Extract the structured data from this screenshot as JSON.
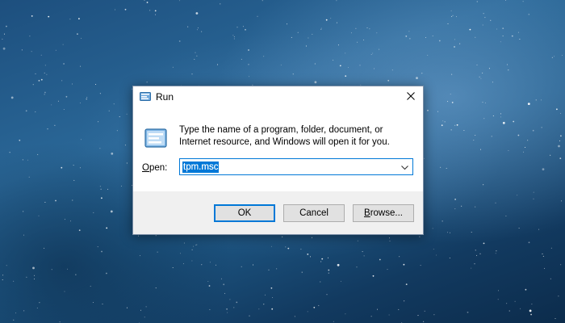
{
  "dialog": {
    "title": "Run",
    "close_icon": "close-icon",
    "app_icon": "run-icon",
    "description": "Type the name of a program, folder, document, or Internet resource, and Windows will open it for you.",
    "open_label_prefix": "O",
    "open_label_rest": "pen:",
    "open_value": "tpm.msc",
    "dropdown_icon": "chevron-down-icon"
  },
  "buttons": {
    "ok": "OK",
    "cancel": "Cancel",
    "browse_prefix": "B",
    "browse_rest": "rowse..."
  },
  "colors": {
    "accent": "#0078d7",
    "footer_bg": "#f0f0f0",
    "button_bg": "#e1e1e1"
  }
}
